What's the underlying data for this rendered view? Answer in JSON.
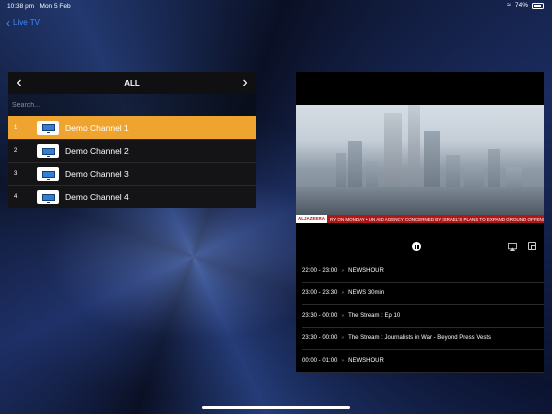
{
  "status_bar": {
    "time": "10:38 pm",
    "date": "Mon 5 Feb",
    "battery": "74%"
  },
  "nav": {
    "back_label": "Live TV"
  },
  "category": {
    "title": "ALL"
  },
  "search": {
    "placeholder": "Search..."
  },
  "channels": [
    {
      "number": "1",
      "name": "Demo Channel 1",
      "active": true
    },
    {
      "number": "2",
      "name": "Demo Channel 2",
      "active": false
    },
    {
      "number": "3",
      "name": "Demo Channel 3",
      "active": false
    },
    {
      "number": "4",
      "name": "Demo Channel 4",
      "active": false
    }
  ],
  "player": {
    "ticker_tag": "ALJAZEERA",
    "ticker_text": "RY ON MONDAY  •  UN AID AGENCY CONCERNED BY ISRAEL'S PLANS TO EXPAND GROUND OFFENSIVE IN"
  },
  "epg": [
    {
      "time": "22:00 - 23:00",
      "title": "NEWSHOUR"
    },
    {
      "time": "23:00 - 23:30",
      "title": "NEWS 30min"
    },
    {
      "time": "23:30 - 00:00",
      "title": "The Stream : Ep 10"
    },
    {
      "time": "23:30 - 00:00",
      "title": "The Stream : Journalists in War - Beyond Press Vests"
    },
    {
      "time": "00:00 - 01:00",
      "title": "NEWSHOUR"
    }
  ],
  "colors": {
    "accent": "#f0a430",
    "link": "#3b8cff",
    "ticker": "#b01818"
  }
}
